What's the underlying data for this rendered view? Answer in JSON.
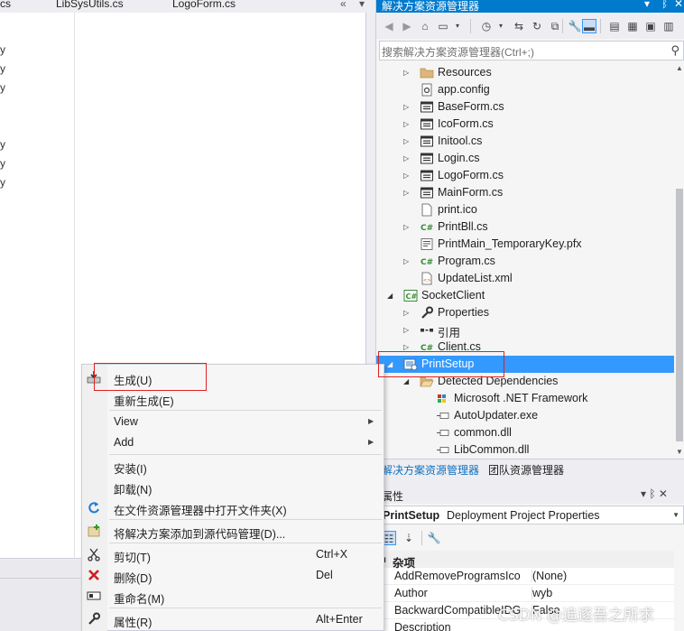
{
  "editor": {
    "tabs": [
      "cs",
      "LibSysUtils.cs",
      "LogoForm.cs"
    ],
    "tab_overflow": "«",
    "tab_pin": "▾",
    "left_lines": [
      "y",
      "y",
      "y",
      "y",
      "y",
      "y"
    ]
  },
  "solution_explorer": {
    "title": "解决方案资源管理器",
    "search_placeholder": "搜索解决方案资源管理器(Ctrl+;)",
    "bottom_tabs": [
      "解决方案资源管理器",
      "团队资源管理器"
    ],
    "items": [
      {
        "label": "Resources",
        "expander": "▷",
        "icon": "folder-icon"
      },
      {
        "label": "app.config",
        "expander": "",
        "icon": "config-icon"
      },
      {
        "label": "BaseForm.cs",
        "expander": "▷",
        "icon": "form-icon"
      },
      {
        "label": "IcoForm.cs",
        "expander": "▷",
        "icon": "form-icon"
      },
      {
        "label": "Initool.cs",
        "expander": "▷",
        "icon": "form-icon"
      },
      {
        "label": "Login.cs",
        "expander": "▷",
        "icon": "form-icon"
      },
      {
        "label": "LogoForm.cs",
        "expander": "▷",
        "icon": "form-icon"
      },
      {
        "label": "MainForm.cs",
        "expander": "▷",
        "icon": "form-icon"
      },
      {
        "label": "print.ico",
        "expander": "",
        "icon": "ico-file-icon"
      },
      {
        "label": "PrintBll.cs",
        "expander": "▷",
        "icon": "csharp-icon"
      },
      {
        "label": "PrintMain_TemporaryKey.pfx",
        "expander": "",
        "icon": "certificate-icon"
      },
      {
        "label": "Program.cs",
        "expander": "▷",
        "icon": "csharp-icon"
      },
      {
        "label": "UpdateList.xml",
        "expander": "",
        "icon": "xml-icon"
      },
      {
        "label": "SocketClient",
        "expander": "◢",
        "icon": "csharp-project-icon"
      },
      {
        "label": "Properties",
        "expander": "▷",
        "icon": "wrench-icon"
      },
      {
        "label": "引用",
        "expander": "▷",
        "icon": "references-icon"
      },
      {
        "label": "Client.cs",
        "expander": "▷",
        "icon": "csharp-icon"
      },
      {
        "label": "PrintSetup",
        "expander": "◢",
        "icon": "setup-project-icon",
        "selected": true
      },
      {
        "label": "Detected Dependencies",
        "expander": "◢",
        "icon": "open-folder-icon"
      },
      {
        "label": "Microsoft .NET Framework",
        "expander": "",
        "icon": "framework-icon"
      },
      {
        "label": "AutoUpdater.exe",
        "expander": "",
        "icon": "dependency-icon"
      },
      {
        "label": "common.dll",
        "expander": "",
        "icon": "dependency-icon"
      },
      {
        "label": "LibCommon.dll",
        "expander": "",
        "icon": "dependency-icon"
      }
    ]
  },
  "properties": {
    "title": "属性",
    "object_name": "PrintSetup",
    "object_type": "Deployment Project Properties",
    "category": "杂项",
    "rows": [
      {
        "name": "AddRemoveProgramsIco",
        "value": "(None)"
      },
      {
        "name": "Author",
        "value": "wyb"
      },
      {
        "name": "BackwardCompatibleIDG",
        "value": "False"
      },
      {
        "name": "Description",
        "value": ""
      }
    ]
  },
  "context_menu": {
    "items": [
      {
        "label": "生成(U)",
        "shortcut": "",
        "submenu": false,
        "icon": "build-icon"
      },
      {
        "label": "重新生成(E)",
        "shortcut": "",
        "submenu": false,
        "icon": ""
      },
      {
        "sep": true
      },
      {
        "label": "View",
        "shortcut": "",
        "submenu": true,
        "icon": ""
      },
      {
        "label": "Add",
        "shortcut": "",
        "submenu": true,
        "icon": ""
      },
      {
        "sep": true
      },
      {
        "label": "安装(I)",
        "shortcut": "",
        "submenu": false,
        "icon": ""
      },
      {
        "label": "卸载(N)",
        "shortcut": "",
        "submenu": false,
        "icon": ""
      },
      {
        "label": "在文件资源管理器中打开文件夹(X)",
        "shortcut": "",
        "submenu": false,
        "icon": "refresh-arrow-icon"
      },
      {
        "sep": true
      },
      {
        "label": "将解决方案添加到源代码管理(D)...",
        "shortcut": "",
        "submenu": false,
        "icon": "source-control-icon"
      },
      {
        "sep": true
      },
      {
        "label": "剪切(T)",
        "shortcut": "Ctrl+X",
        "submenu": false,
        "icon": "scissors-icon"
      },
      {
        "label": "删除(D)",
        "shortcut": "Del",
        "submenu": false,
        "icon": "delete-x-icon"
      },
      {
        "label": "重命名(M)",
        "shortcut": "",
        "submenu": false,
        "icon": "rename-icon"
      },
      {
        "sep": true
      },
      {
        "label": "属性(R)",
        "shortcut": "Alt+Enter",
        "submenu": false,
        "icon": "wrench-icon"
      }
    ]
  },
  "watermark": "CSDN @追逐吾之所求",
  "colors": {
    "accent": "#007acc",
    "selection": "#3399ff",
    "highlight_box": "#e02020"
  }
}
